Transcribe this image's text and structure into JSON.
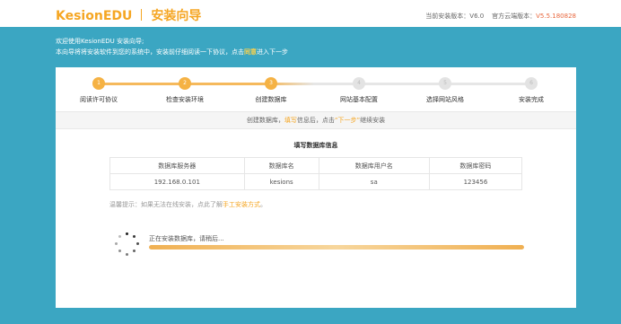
{
  "header": {
    "brand": "KesionEDU",
    "title": "安装向导",
    "current_version_label": "当前安装版本：",
    "current_version": "V6.0",
    "cloud_version_label": "官方云端版本：",
    "cloud_version": "V5.5.180828"
  },
  "intro": {
    "line1": "欢迎使用KesionEDU 安装向导;",
    "line2_prefix": "本向导将将安装软件到您的系统中，安装前仔细阅读一下协议，点击",
    "line2_highlight": "同意",
    "line2_suffix": "进入下一步"
  },
  "steps": [
    {
      "num": "1",
      "label": "阅读许可协议",
      "state": "done"
    },
    {
      "num": "2",
      "label": "检查安装环境",
      "state": "done"
    },
    {
      "num": "3",
      "label": "创建数据库",
      "state": "done"
    },
    {
      "num": "4",
      "label": "网站基本配置",
      "state": "todo"
    },
    {
      "num": "5",
      "label": "选择网站风格",
      "state": "todo"
    },
    {
      "num": "6",
      "label": "安装完成",
      "state": "todo"
    }
  ],
  "notice": {
    "prefix": "创建数据库，",
    "fill": "填写",
    "middle": "信息后，点击",
    "next": "“下一步”",
    "suffix": "继续安装"
  },
  "db_section_title": "填写数据库信息",
  "db_table": {
    "headers": [
      "数据库服务器",
      "数据库名",
      "数据库用户名",
      "数据库密码"
    ],
    "row": [
      "192.168.0.101",
      "kesions",
      "sa",
      "123456"
    ]
  },
  "tip": {
    "prefix": "温馨提示：如果无法在线安装，点此了解",
    "link": "手工安装方式",
    "suffix": "。"
  },
  "progress": {
    "label": "正在安装数据库，请稍后...",
    "value": 1.0
  },
  "colors": {
    "accent": "#f5a623",
    "background": "#3ba6c2",
    "cloud_version": "#e8673d"
  }
}
